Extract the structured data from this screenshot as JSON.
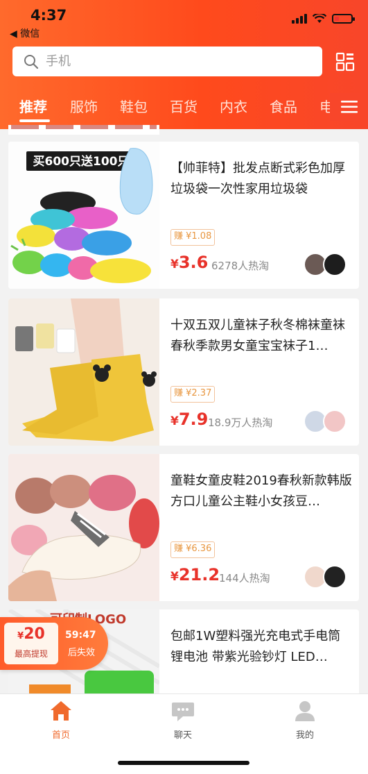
{
  "status": {
    "time": "4:37",
    "back_app": "◀ 微信"
  },
  "search": {
    "placeholder": "手机"
  },
  "tabs": [
    {
      "label": "推荐"
    },
    {
      "label": "服饰"
    },
    {
      "label": "鞋包"
    },
    {
      "label": "百货"
    },
    {
      "label": "内衣"
    },
    {
      "label": "食品"
    },
    {
      "label": "电"
    }
  ],
  "products": [
    {
      "title": "【帅菲特】批发点断式彩色加厚垃圾袋一次性家用垃圾袋",
      "banner": "买600只送100只",
      "earn": "赚 ¥1.08",
      "price_symbol": "¥",
      "price": "3.6",
      "hot": "6278人热淘"
    },
    {
      "title": "十双五双儿童袜子秋冬棉袜童袜春秋季款男女童宝宝袜子1…",
      "earn": "赚 ¥2.37",
      "price_symbol": "¥",
      "price": "7.9",
      "hot": "18.9万人热淘"
    },
    {
      "title": "童鞋女童皮鞋2019春秋新款韩版方口儿童公主鞋小女孩豆…",
      "earn": "赚 ¥6.36",
      "price_symbol": "¥",
      "price": "21.2",
      "hot": "144人热淘"
    },
    {
      "title": "包邮1W塑料强光充电式手电筒锂电池 带紫光验钞灯 LED…",
      "banner": "可印制LOGO"
    }
  ],
  "promo": {
    "symbol": "¥",
    "amount": "20",
    "label": "最高提现",
    "timer": "59:47",
    "after": "后失效"
  },
  "bottom_nav": [
    {
      "label": "首页",
      "icon": "home-icon"
    },
    {
      "label": "聊天",
      "icon": "chat-icon"
    },
    {
      "label": "我的",
      "icon": "profile-icon"
    }
  ],
  "colors": {
    "brand": "#ff4a1c",
    "price": "#e8322a",
    "earn": "#e8963f"
  }
}
